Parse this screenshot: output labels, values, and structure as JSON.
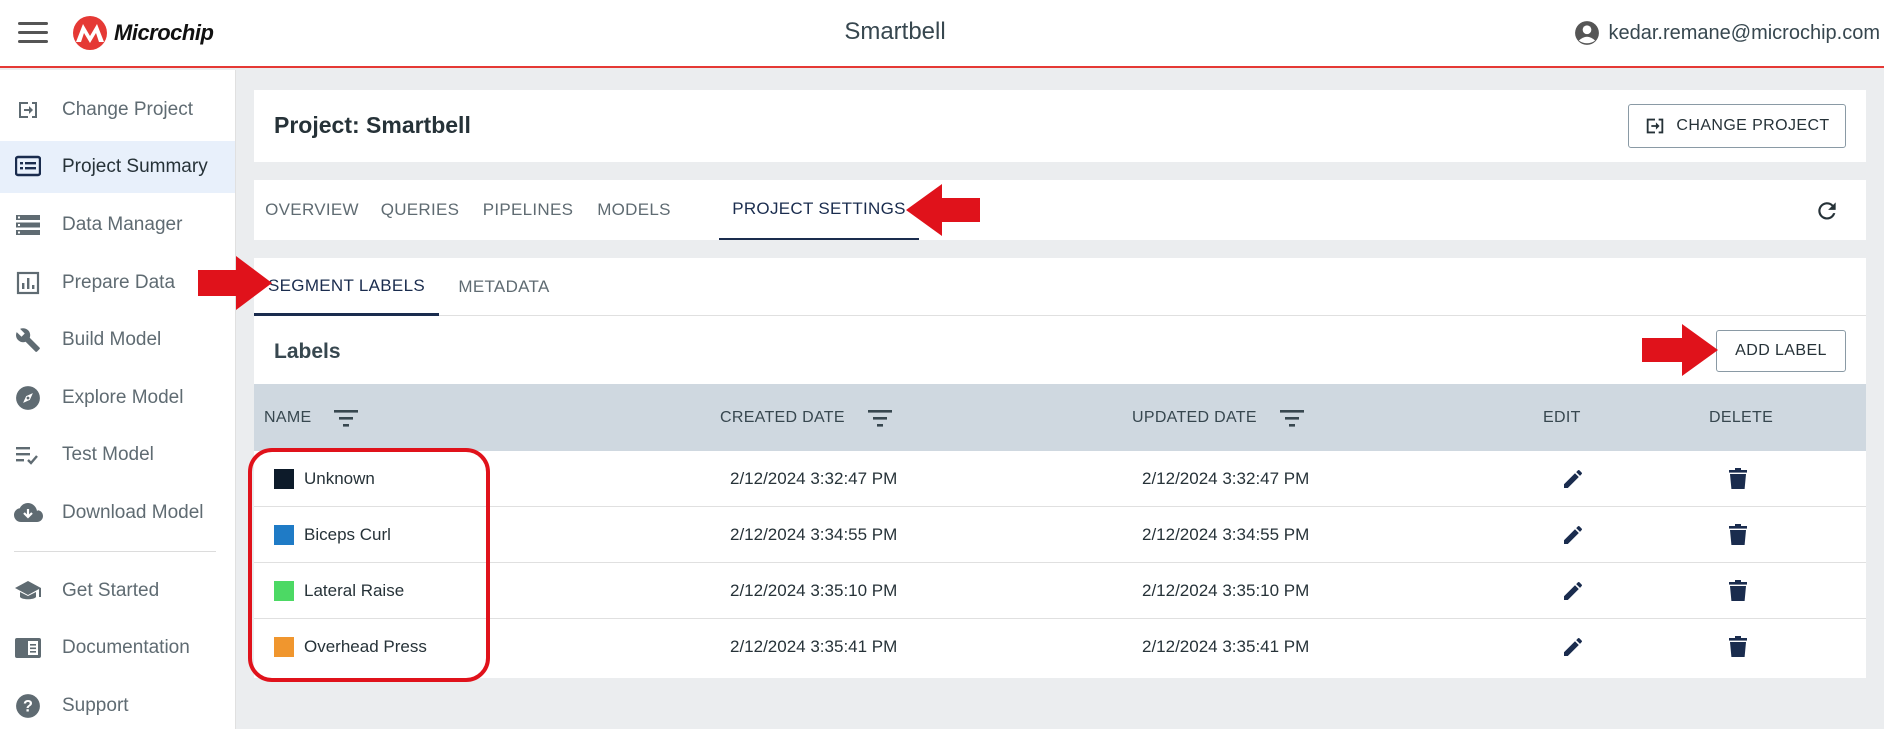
{
  "header": {
    "menu_icon": "hamburger-menu-icon",
    "logo_text": "Microchip",
    "app_title": "Smartbell",
    "user_email": "kedar.remane@microchip.com",
    "user_icon": "account-circle-icon"
  },
  "sidebar": {
    "items": [
      {
        "label": "Change Project",
        "icon": "enter-project-icon"
      },
      {
        "label": "Project Summary",
        "icon": "summary-icon",
        "active": true
      },
      {
        "label": "Data Manager",
        "icon": "storage-icon"
      },
      {
        "label": "Prepare Data",
        "icon": "chart-icon"
      },
      {
        "label": "Build Model",
        "icon": "wrench-icon"
      },
      {
        "label": "Explore Model",
        "icon": "compass-icon"
      },
      {
        "label": "Test Model",
        "icon": "checklist-icon"
      },
      {
        "label": "Download Model",
        "icon": "cloud-download-icon"
      },
      {
        "label": "Get Started",
        "icon": "school-icon"
      },
      {
        "label": "Documentation",
        "icon": "book-icon"
      },
      {
        "label": "Support",
        "icon": "help-icon"
      }
    ]
  },
  "project": {
    "title": "Project: Smartbell",
    "change_button": "CHANGE PROJECT"
  },
  "tabs": [
    {
      "label": "OVERVIEW"
    },
    {
      "label": "QUERIES"
    },
    {
      "label": "PIPELINES"
    },
    {
      "label": "MODELS"
    },
    {
      "label": "PROJECT SETTINGS",
      "active": true
    }
  ],
  "subtabs": [
    {
      "label": "SEGMENT LABELS",
      "active": true
    },
    {
      "label": "METADATA"
    }
  ],
  "labels_section": {
    "title": "Labels",
    "add_button": "ADD LABEL"
  },
  "table": {
    "columns": [
      "NAME",
      "CREATED DATE",
      "UPDATED DATE",
      "EDIT",
      "DELETE"
    ],
    "rows": [
      {
        "name": "Unknown",
        "color": "#0d1b2a",
        "created": "2/12/2024 3:32:47 PM",
        "updated": "2/12/2024 3:32:47 PM"
      },
      {
        "name": "Biceps Curl",
        "color": "#1f7bc6",
        "created": "2/12/2024 3:34:55 PM",
        "updated": "2/12/2024 3:34:55 PM"
      },
      {
        "name": "Lateral Raise",
        "color": "#4cd964",
        "created": "2/12/2024 3:35:10 PM",
        "updated": "2/12/2024 3:35:10 PM"
      },
      {
        "name": "Overhead Press",
        "color": "#f0962e",
        "created": "2/12/2024 3:35:41 PM",
        "updated": "2/12/2024 3:35:41 PM"
      }
    ]
  },
  "colors": {
    "accent_red": "#e53935",
    "annotation_red": "#e0121b",
    "active_tab": "#1a2c4e",
    "table_header_bg": "#cfd8e0"
  }
}
